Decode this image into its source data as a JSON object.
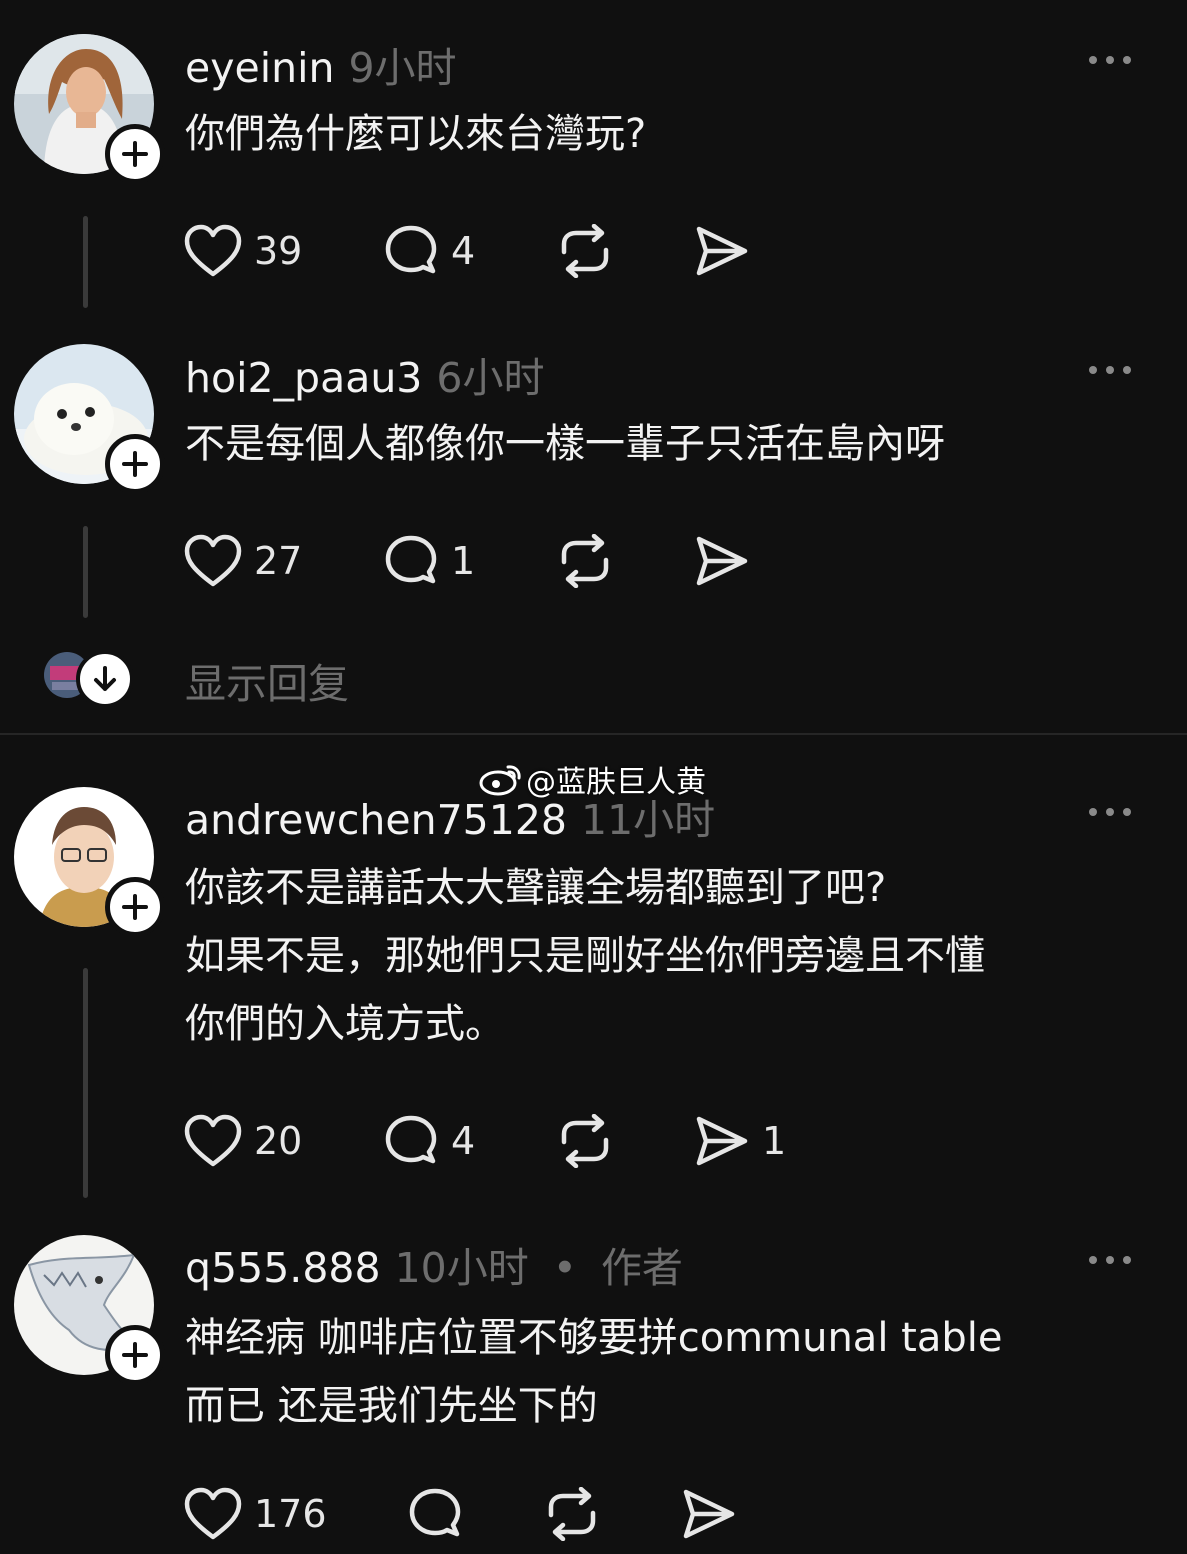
{
  "watermark": {
    "icon": "weibo-icon",
    "text": "@蓝肤巨人黄"
  },
  "show_replies": {
    "label": "显示回复"
  },
  "comments": [
    {
      "username": "eyeinin",
      "time": "9小时",
      "lines": [
        "你們為什麼可以來台灣玩?"
      ],
      "likes": "39",
      "replies": "4",
      "shares": ""
    },
    {
      "username": "hoi2_paau3",
      "time": "6小时",
      "lines": [
        "不是每個人都像你一樣一輩子只活在島內呀"
      ],
      "likes": "27",
      "replies": "1",
      "shares": ""
    },
    {
      "username": "andrewchen75128",
      "time": "11小时",
      "lines": [
        "你該不是講話太大聲讓全場都聽到了吧?",
        "如果不是，那她們只是剛好坐你們旁邊且不懂",
        "你們的入境方式。"
      ],
      "likes": "20",
      "replies": "4",
      "shares": "1"
    },
    {
      "username": "q555.888",
      "time": "10小时",
      "separator": "•",
      "author_tag": "作者",
      "lines": [
        "神经病 咖啡店位置不够要拼communal table",
        "而已 还是我们先坐下的"
      ],
      "likes": "176",
      "replies": "",
      "shares": ""
    }
  ],
  "colors": {
    "background": "#101010",
    "text": "#f3f3f3",
    "muted": "#6d6d6d",
    "thread": "#3a3a3a"
  }
}
